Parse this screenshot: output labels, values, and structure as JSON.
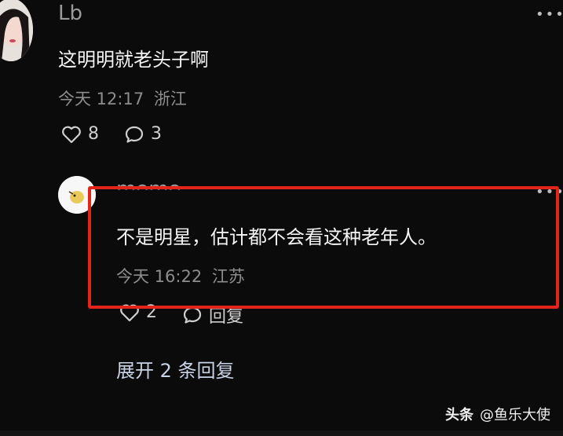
{
  "comment1": {
    "username": "Lb",
    "text": "这明明就老头子啊",
    "time": "今天 12:17",
    "location": "浙江",
    "likes": "8",
    "replies": "3"
  },
  "reply1": {
    "username": "momo",
    "text": "不是明星，估计都不会看这种老年人。",
    "time": "今天 16:22",
    "location": "江苏",
    "likes": "2",
    "reply_label": "回复"
  },
  "expand_replies": "展开 2 条回复",
  "watermark": {
    "brand": "头条",
    "handle": "@鱼乐大使"
  },
  "colors": {
    "highlight_box": "#e1251b",
    "background": "#0b0b0b"
  }
}
